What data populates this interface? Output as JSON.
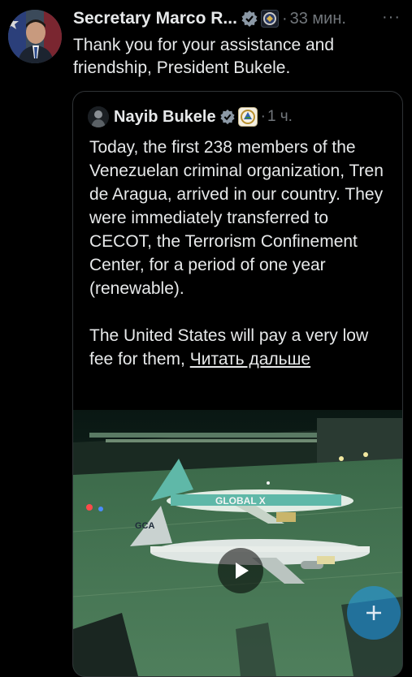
{
  "tweet": {
    "author_name": "Secretary Marco R...",
    "dot": "·",
    "time": "33 мин.",
    "more": "···",
    "text": "Thank you for your assistance and friendship, President Bukele.",
    "icons": {
      "avatar": "avatar-photo",
      "verified": "verified-badge-icon",
      "affiliate": "state-department-seal-icon",
      "more": "more-options-icon"
    }
  },
  "quote": {
    "author_name": "Nayib Bukele",
    "dot": "·",
    "time": "1 ч.",
    "text": "Today, the first 238 members of the Venezuelan criminal organization, Tren de Aragua, arrived in our country. They were immediately transferred to CECOT, the Terrorism Confinement Center, for a period of one year (renewable).",
    "text2": "The United States will pay a very low fee for them, ",
    "read_more": "Читать дальше",
    "media": {
      "type": "video-thumbnail",
      "plane1_livery": "GLOBAL X",
      "plane2_tail": "GCA",
      "play_icon": "play-icon"
    },
    "icons": {
      "avatar": "avatar-icon",
      "verified": "verified-badge-icon",
      "affiliate": "el-salvador-seal-icon"
    }
  },
  "fab": {
    "icon": "compose-plus-icon"
  },
  "colors": {
    "background": "#000000",
    "text": "#e7e9ea",
    "muted": "#71767b",
    "border": "#2f3336",
    "verified": "#8b98a5",
    "fab": "#1d9bf0"
  }
}
